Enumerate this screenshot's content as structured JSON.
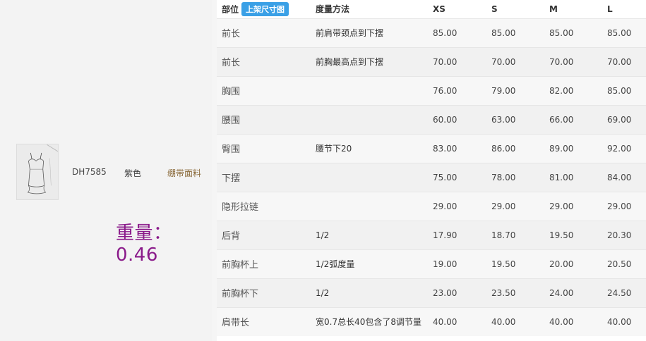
{
  "product": {
    "sku": "DH7585",
    "color": "紫色",
    "fabric": "绷带面料",
    "weight_text": "重量：0.46"
  },
  "table": {
    "header": {
      "part": "部位",
      "upload_button": "上架尺寸图",
      "method": "度量方法",
      "sizes": [
        "XS",
        "S",
        "M",
        "L"
      ]
    },
    "rows": [
      {
        "part": "前长",
        "method": "前肩带颈点到下摆",
        "values": [
          "85.00",
          "85.00",
          "85.00",
          "85.00"
        ]
      },
      {
        "part": "前长",
        "method": "前胸最高点到下摆",
        "values": [
          "70.00",
          "70.00",
          "70.00",
          "70.00"
        ]
      },
      {
        "part": "胸围",
        "method": "",
        "values": [
          "76.00",
          "79.00",
          "82.00",
          "85.00"
        ]
      },
      {
        "part": "腰围",
        "method": "",
        "values": [
          "60.00",
          "63.00",
          "66.00",
          "69.00"
        ]
      },
      {
        "part": "臀围",
        "method": "腰节下20",
        "values": [
          "83.00",
          "86.00",
          "89.00",
          "92.00"
        ]
      },
      {
        "part": "下摆",
        "method": "",
        "values": [
          "75.00",
          "78.00",
          "81.00",
          "84.00"
        ]
      },
      {
        "part": "隐形拉链",
        "method": "",
        "values": [
          "29.00",
          "29.00",
          "29.00",
          "29.00"
        ]
      },
      {
        "part": "后背",
        "method": "1/2",
        "values": [
          "17.90",
          "18.70",
          "19.50",
          "20.30"
        ]
      },
      {
        "part": "前胸杯上",
        "method": "1/2弧度量",
        "values": [
          "19.00",
          "19.50",
          "20.00",
          "20.50"
        ]
      },
      {
        "part": "前胸杯下",
        "method": "1/2",
        "values": [
          "23.00",
          "23.50",
          "24.00",
          "24.50"
        ]
      },
      {
        "part": "肩带长",
        "method": "宽0.7总长40包含了8调节量",
        "values": [
          "40.00",
          "40.00",
          "40.00",
          "40.00"
        ]
      }
    ]
  }
}
